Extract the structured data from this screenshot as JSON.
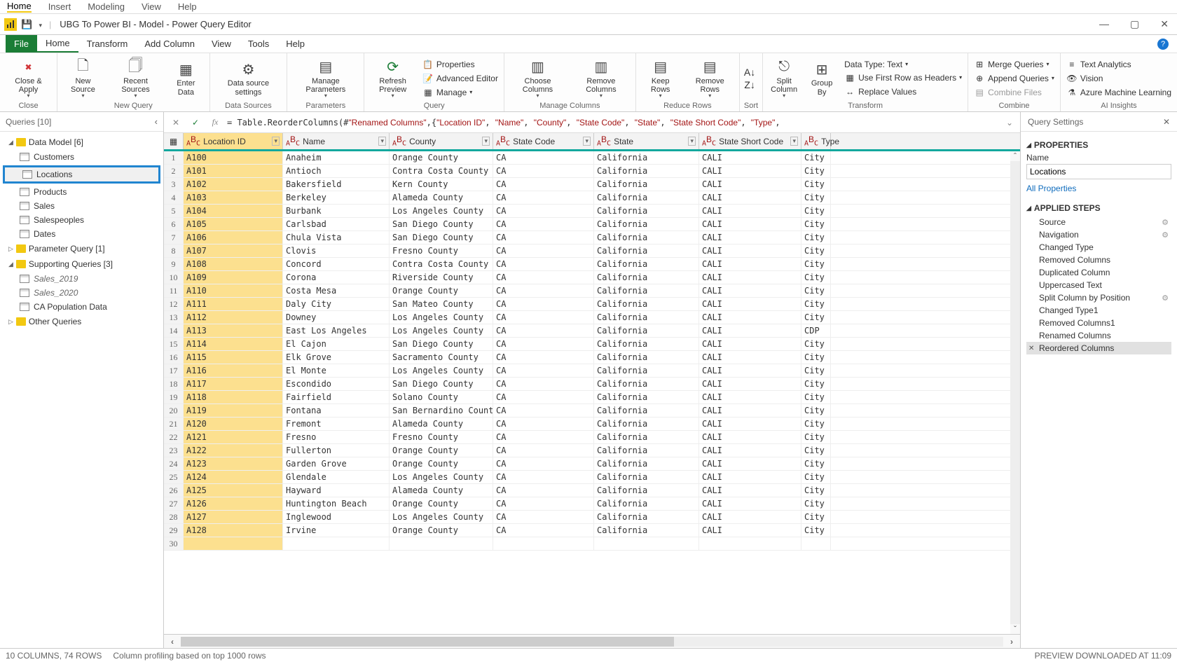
{
  "top_menu": {
    "items": [
      "Home",
      "Insert",
      "Modeling",
      "View",
      "Help"
    ],
    "active": "Home"
  },
  "title_bar": {
    "title": "UBG To Power BI - Model - Power Query Editor"
  },
  "ribbon_tabs": {
    "items": [
      "File",
      "Home",
      "Transform",
      "Add Column",
      "View",
      "Tools",
      "Help"
    ],
    "file": "File",
    "active": "Home"
  },
  "ribbon": {
    "close": {
      "close_apply": "Close &\nApply",
      "group": "Close"
    },
    "new_query": {
      "new_source": "New\nSource",
      "recent_sources": "Recent\nSources",
      "enter_data": "Enter\nData",
      "group": "New Query"
    },
    "data_sources": {
      "ds_settings": "Data source\nsettings",
      "group": "Data Sources"
    },
    "parameters": {
      "manage_params": "Manage\nParameters",
      "group": "Parameters"
    },
    "query": {
      "refresh": "Refresh\nPreview",
      "properties": "Properties",
      "advanced": "Advanced Editor",
      "manage": "Manage",
      "group": "Query"
    },
    "manage_cols": {
      "choose": "Choose\nColumns",
      "remove": "Remove\nColumns",
      "group": "Manage Columns"
    },
    "reduce": {
      "keep": "Keep\nRows",
      "remove": "Remove\nRows",
      "group": "Reduce Rows"
    },
    "sort": {
      "group": "Sort"
    },
    "transform": {
      "split": "Split\nColumn",
      "group_by": "Group\nBy",
      "data_type": "Data Type: Text",
      "first_row": "Use First Row as Headers",
      "replace": "Replace Values",
      "group": "Transform"
    },
    "combine": {
      "merge": "Merge Queries",
      "append": "Append Queries",
      "combine_files": "Combine Files",
      "group": "Combine"
    },
    "ai": {
      "text_analytics": "Text Analytics",
      "vision": "Vision",
      "ml": "Azure Machine Learning",
      "group": "AI Insights"
    }
  },
  "queries": {
    "title": "Queries [10]",
    "folders": [
      {
        "name": "Data Model [6]",
        "expanded": true,
        "items": [
          {
            "name": "Customers"
          },
          {
            "name": "Locations",
            "selected": true
          },
          {
            "name": "Products"
          },
          {
            "name": "Sales"
          },
          {
            "name": "Salespeoples"
          },
          {
            "name": "Dates"
          }
        ]
      },
      {
        "name": "Parameter Query [1]",
        "expanded": false,
        "items": []
      },
      {
        "name": "Supporting Queries [3]",
        "expanded": true,
        "items": [
          {
            "name": "Sales_2019",
            "italic": true
          },
          {
            "name": "Sales_2020",
            "italic": true
          },
          {
            "name": "CA Population Data"
          }
        ]
      },
      {
        "name": "Other Queries",
        "expanded": false,
        "items": [],
        "nodecor": true
      }
    ]
  },
  "formula": {
    "prefix": "= Table.ReorderColumns(#",
    "parts": [
      "\"Renamed Columns\"",
      ",{",
      "\"Location ID\"",
      ", ",
      "\"Name\"",
      ", ",
      "\"County\"",
      ", ",
      "\"State Code\"",
      ", ",
      "\"State\"",
      ", ",
      "\"State Short Code\"",
      ", ",
      "\"Type\"",
      ","
    ]
  },
  "table": {
    "columns": [
      {
        "name": "Location ID",
        "key": true
      },
      {
        "name": "Name"
      },
      {
        "name": "County"
      },
      {
        "name": "State Code"
      },
      {
        "name": "State"
      },
      {
        "name": "State Short Code"
      },
      {
        "name": "Type"
      }
    ],
    "rows": [
      [
        "A100",
        "Anaheim",
        "Orange County",
        "CA",
        "California",
        "CALI",
        "City"
      ],
      [
        "A101",
        "Antioch",
        "Contra Costa County",
        "CA",
        "California",
        "CALI",
        "City"
      ],
      [
        "A102",
        "Bakersfield",
        "Kern County",
        "CA",
        "California",
        "CALI",
        "City"
      ],
      [
        "A103",
        "Berkeley",
        "Alameda County",
        "CA",
        "California",
        "CALI",
        "City"
      ],
      [
        "A104",
        "Burbank",
        "Los Angeles County",
        "CA",
        "California",
        "CALI",
        "City"
      ],
      [
        "A105",
        "Carlsbad",
        "San Diego County",
        "CA",
        "California",
        "CALI",
        "City"
      ],
      [
        "A106",
        "Chula Vista",
        "San Diego County",
        "CA",
        "California",
        "CALI",
        "City"
      ],
      [
        "A107",
        "Clovis",
        "Fresno County",
        "CA",
        "California",
        "CALI",
        "City"
      ],
      [
        "A108",
        "Concord",
        "Contra Costa County",
        "CA",
        "California",
        "CALI",
        "City"
      ],
      [
        "A109",
        "Corona",
        "Riverside County",
        "CA",
        "California",
        "CALI",
        "City"
      ],
      [
        "A110",
        "Costa Mesa",
        "Orange County",
        "CA",
        "California",
        "CALI",
        "City"
      ],
      [
        "A111",
        "Daly City",
        "San Mateo County",
        "CA",
        "California",
        "CALI",
        "City"
      ],
      [
        "A112",
        "Downey",
        "Los Angeles County",
        "CA",
        "California",
        "CALI",
        "City"
      ],
      [
        "A113",
        "East Los Angeles",
        "Los Angeles County",
        "CA",
        "California",
        "CALI",
        "CDP"
      ],
      [
        "A114",
        "El Cajon",
        "San Diego County",
        "CA",
        "California",
        "CALI",
        "City"
      ],
      [
        "A115",
        "Elk Grove",
        "Sacramento County",
        "CA",
        "California",
        "CALI",
        "City"
      ],
      [
        "A116",
        "El Monte",
        "Los Angeles County",
        "CA",
        "California",
        "CALI",
        "City"
      ],
      [
        "A117",
        "Escondido",
        "San Diego County",
        "CA",
        "California",
        "CALI",
        "City"
      ],
      [
        "A118",
        "Fairfield",
        "Solano County",
        "CA",
        "California",
        "CALI",
        "City"
      ],
      [
        "A119",
        "Fontana",
        "San Bernardino County",
        "CA",
        "California",
        "CALI",
        "City"
      ],
      [
        "A120",
        "Fremont",
        "Alameda County",
        "CA",
        "California",
        "CALI",
        "City"
      ],
      [
        "A121",
        "Fresno",
        "Fresno County",
        "CA",
        "California",
        "CALI",
        "City"
      ],
      [
        "A122",
        "Fullerton",
        "Orange County",
        "CA",
        "California",
        "CALI",
        "City"
      ],
      [
        "A123",
        "Garden Grove",
        "Orange County",
        "CA",
        "California",
        "CALI",
        "City"
      ],
      [
        "A124",
        "Glendale",
        "Los Angeles County",
        "CA",
        "California",
        "CALI",
        "City"
      ],
      [
        "A125",
        "Hayward",
        "Alameda County",
        "CA",
        "California",
        "CALI",
        "City"
      ],
      [
        "A126",
        "Huntington Beach",
        "Orange County",
        "CA",
        "California",
        "CALI",
        "City"
      ],
      [
        "A127",
        "Inglewood",
        "Los Angeles County",
        "CA",
        "California",
        "CALI",
        "City"
      ],
      [
        "A128",
        "Irvine",
        "Orange County",
        "CA",
        "California",
        "CALI",
        "City"
      ],
      [
        "",
        "",
        "",
        "",
        "",
        "",
        ""
      ]
    ]
  },
  "settings": {
    "title": "Query Settings",
    "properties_label": "PROPERTIES",
    "name_label": "Name",
    "name_value": "Locations",
    "all_properties": "All Properties",
    "applied_steps_label": "APPLIED STEPS",
    "steps": [
      {
        "name": "Source",
        "gear": true
      },
      {
        "name": "Navigation",
        "gear": true
      },
      {
        "name": "Changed Type"
      },
      {
        "name": "Removed Columns"
      },
      {
        "name": "Duplicated Column"
      },
      {
        "name": "Uppercased Text"
      },
      {
        "name": "Split Column by Position",
        "gear": true
      },
      {
        "name": "Changed Type1"
      },
      {
        "name": "Removed Columns1"
      },
      {
        "name": "Renamed Columns"
      },
      {
        "name": "Reordered Columns",
        "selected": true
      }
    ]
  },
  "status": {
    "left1": "10 COLUMNS, 74 ROWS",
    "left2": "Column profiling based on top 1000 rows",
    "right": "PREVIEW DOWNLOADED AT 11:09"
  }
}
